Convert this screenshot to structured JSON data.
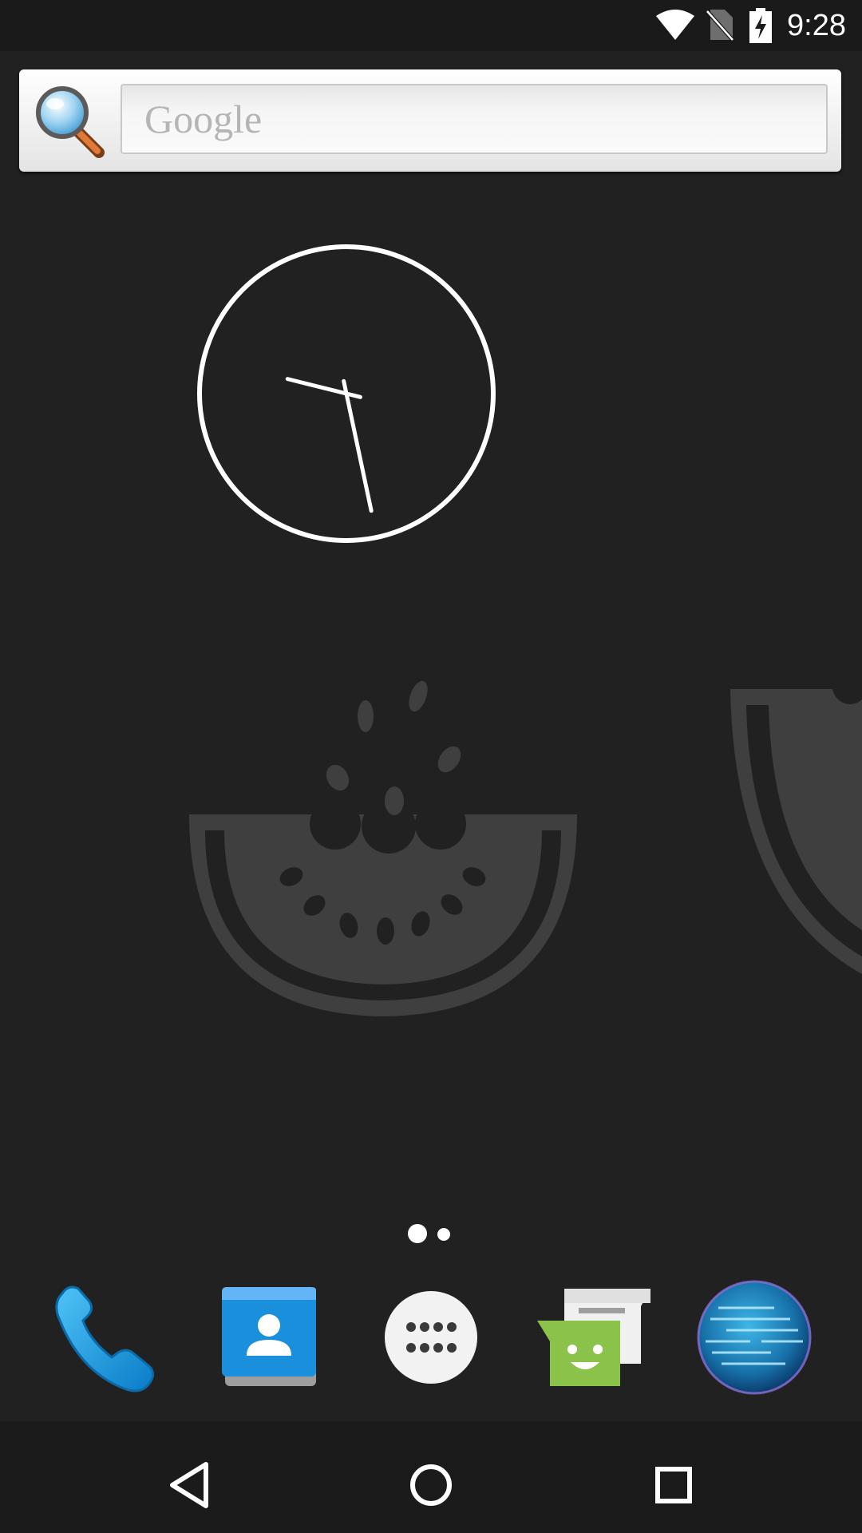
{
  "status_bar": {
    "time": "9:28",
    "icons": [
      "wifi-icon",
      "no-sim-icon",
      "battery-charging-icon"
    ]
  },
  "search_widget": {
    "placeholder": "Google",
    "icon": "magnifier-icon"
  },
  "clock_widget": {
    "type": "analog",
    "hours": 9,
    "minutes": 28
  },
  "wallpaper": {
    "motif": "watermelon-slice"
  },
  "home_pages": {
    "count": 2,
    "current": 1
  },
  "dock": {
    "apps": [
      {
        "icon": "phone-icon"
      },
      {
        "icon": "contacts-icon"
      },
      {
        "icon": "app-drawer-icon"
      },
      {
        "icon": "messaging-icon"
      },
      {
        "icon": "browser-globe-icon"
      }
    ]
  },
  "nav_bar": {
    "buttons": [
      "back-icon",
      "home-icon",
      "recents-icon"
    ]
  },
  "colors": {
    "background": "#212121",
    "wallpaper_motif": "#3f3f3f",
    "phone_blue": "#1e9fe6",
    "contacts_blue": "#1a8fdc",
    "messaging_green": "#8bc34a",
    "globe_blue": "#2a9fd8"
  }
}
